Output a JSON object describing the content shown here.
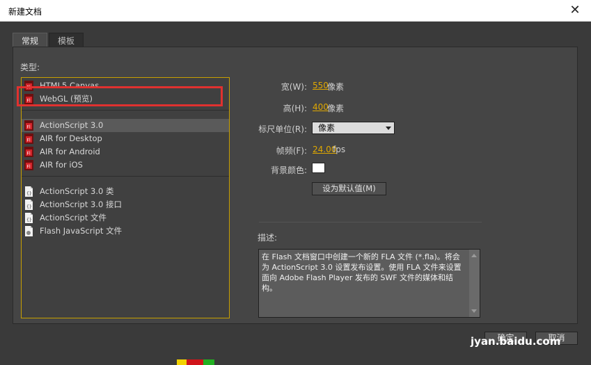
{
  "window": {
    "title": "新建文档"
  },
  "tabs": [
    {
      "label": "常规"
    },
    {
      "label": "模板"
    }
  ],
  "type_section": {
    "label": "类型:"
  },
  "types": [
    {
      "label": "HTML5 Canvas"
    },
    {
      "label": "WebGL (预览)"
    },
    {
      "label": "ActionScript 3.0"
    },
    {
      "label": "AIR for Desktop"
    },
    {
      "label": "AIR for Android"
    },
    {
      "label": "AIR for iOS"
    },
    {
      "label": "ActionScript 3.0 类"
    },
    {
      "label": "ActionScript 3.0 接口"
    },
    {
      "label": "ActionScript 文件"
    },
    {
      "label": "Flash JavaScript 文件"
    }
  ],
  "properties": {
    "width_label": "宽(W):",
    "width_value": "550",
    "width_unit": "像素",
    "height_label": "高(H):",
    "height_value": "400",
    "height_unit": "像素",
    "ruler_label": "标尺单位(R):",
    "ruler_value": "像素",
    "fps_label": "帧频(F):",
    "fps_value": "24.00",
    "fps_unit": "fps",
    "bg_label": "背景颜色:",
    "bg_color": "#ffffff",
    "default_button": "设为默认值(M)"
  },
  "description": {
    "label": "描述:",
    "text": "在 Flash 文档窗口中创建一个新的 FLA 文件 (*.fla)。将会为 ActionScript 3.0 设置发布设置。使用 FLA 文件来设置面向 Adobe Flash Player 发布的 SWF 文件的媒体和结构。"
  },
  "footer": {
    "ok_label": "确定",
    "cancel_label": "取消"
  },
  "watermark": {
    "text": "jyan.baidu.com"
  },
  "colors": {
    "accent": "#e0a800",
    "selection_frame": "#e0312f",
    "list_border": "#c8a000"
  }
}
